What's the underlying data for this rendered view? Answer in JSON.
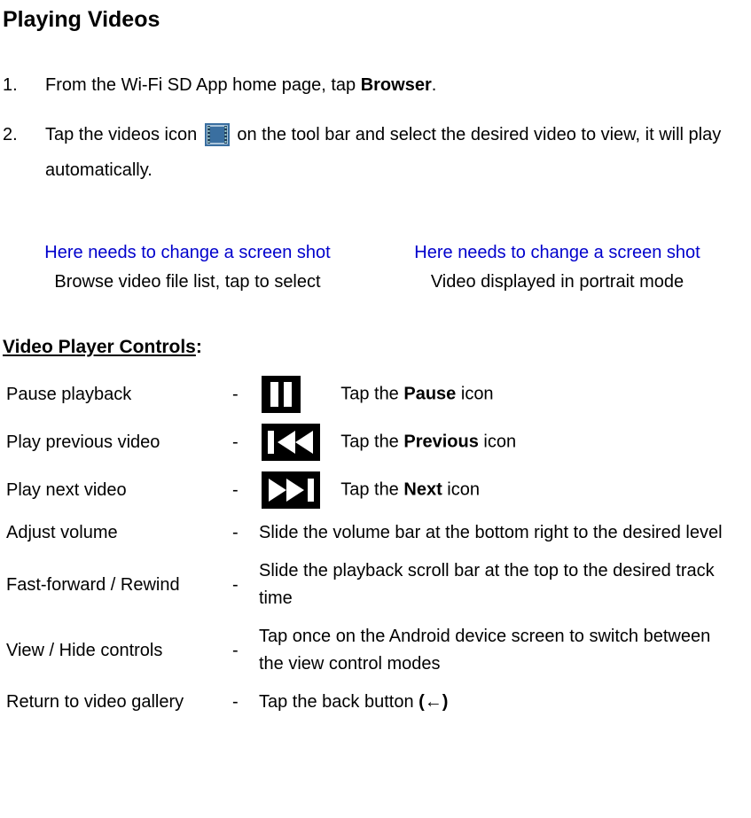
{
  "heading": "Playing Videos",
  "steps": {
    "s1": {
      "num": "1.",
      "pre": "From the Wi-Fi SD App home page, tap ",
      "bold": "Browser",
      "post": "."
    },
    "s2": {
      "num": "2.",
      "pre": "Tap the videos icon ",
      "post": " on the tool bar and select the desired video to view, it will play automatically."
    }
  },
  "captions": {
    "left": {
      "note": "Here needs to change a screen shot",
      "cap": "Browse video file list, tap to select"
    },
    "right": {
      "note": "Here needs to change a screen shot",
      "cap": "Video displayed in portrait mode"
    }
  },
  "subheading": {
    "ul": "Video Player Controls",
    "colon": ":"
  },
  "dash": "-",
  "controls": {
    "pause": {
      "label": "Pause playback",
      "desc_pre": "Tap the ",
      "desc_bold": "Pause",
      "desc_post": " icon"
    },
    "prev": {
      "label": "Play previous video",
      "desc_pre": "Tap the ",
      "desc_bold": "Previous",
      "desc_post": " icon"
    },
    "next": {
      "label": "Play next video",
      "desc_pre": "Tap the ",
      "desc_bold": "Next",
      "desc_post": " icon"
    },
    "volume": {
      "label": "Adjust volume",
      "desc": "Slide the volume bar at the bottom right to the desired level"
    },
    "seek": {
      "label": "Fast-forward / Rewind",
      "desc": "Slide the playback scroll bar at the top to the desired track time"
    },
    "toggle": {
      "label": "View / Hide controls",
      "desc": "Tap once on the Android device screen to switch between the view control modes"
    },
    "back": {
      "label": "Return to video gallery",
      "desc_pre": "Tap the back button ",
      "desc_bold": "(←)",
      "desc_post": ""
    }
  }
}
